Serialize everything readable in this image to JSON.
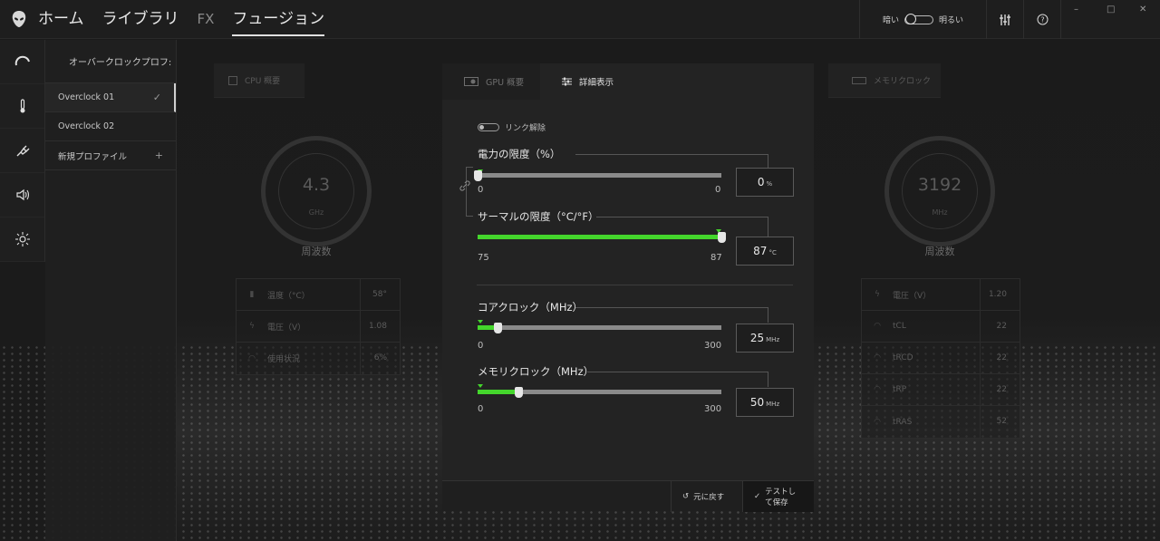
{
  "nav": {
    "items": [
      {
        "label": "ホーム"
      },
      {
        "label": "ライブラリ"
      },
      {
        "label": "FX"
      },
      {
        "label": "フュージョン"
      }
    ]
  },
  "theme": {
    "dark_label": "暗い",
    "light_label": "明るい"
  },
  "window": {
    "minimize": "–",
    "maximize": "□",
    "close": "✕"
  },
  "profiles": {
    "title": "オーバークロックプロフ:",
    "items": [
      {
        "label": "Overclock 01",
        "mark": "✓"
      },
      {
        "label": "Overclock 02",
        "mark": ""
      },
      {
        "label": "新規プロファイル",
        "mark": "+"
      }
    ]
  },
  "cpu": {
    "tab_label": "CPU 概要",
    "gauge_value": "4.3",
    "gauge_unit": "GHz",
    "caption": "周波数",
    "stats": [
      {
        "label": "温度（°C）",
        "value": "58°"
      },
      {
        "label": "電圧（V）",
        "value": "1.08"
      },
      {
        "label": "使用状況",
        "value": "6%"
      }
    ]
  },
  "gpu": {
    "tab_overview": "GPU 概要",
    "tab_detail": "詳細表示",
    "link_toggle_label": "リンク解除",
    "power": {
      "title": "電力の限度（%）",
      "min": "0",
      "max": "0",
      "value": "0",
      "unit": "%",
      "level": 0
    },
    "thermal": {
      "title": "サーマルの限度（°C/°F）",
      "min": "75",
      "max": "87",
      "value": "87",
      "unit": "°C",
      "level": 1
    },
    "core": {
      "title": "コアクロック（MHz）",
      "min": "0",
      "max": "300",
      "value": "25",
      "unit": "MHz",
      "level": 0.083
    },
    "memory": {
      "title": "メモリクロック（MHz）",
      "min": "0",
      "max": "300",
      "value": "50",
      "unit": "MHz",
      "level": 0.167
    },
    "revert_label": "元に戻す",
    "save_label": "テストして保存"
  },
  "mem": {
    "tab_label": "メモリクロック",
    "gauge_value": "3192",
    "gauge_unit": "MHz",
    "caption": "周波数",
    "stats": [
      {
        "label": "電圧（V）",
        "value": "1.20"
      },
      {
        "label": "tCL",
        "value": "22"
      },
      {
        "label": "tRCD",
        "value": "22"
      },
      {
        "label": "tRP",
        "value": "22"
      },
      {
        "label": "tRAS",
        "value": "52"
      }
    ]
  },
  "colors": {
    "accent": "#44d62c",
    "background": "#1b1b1b",
    "panel": "#232323"
  }
}
